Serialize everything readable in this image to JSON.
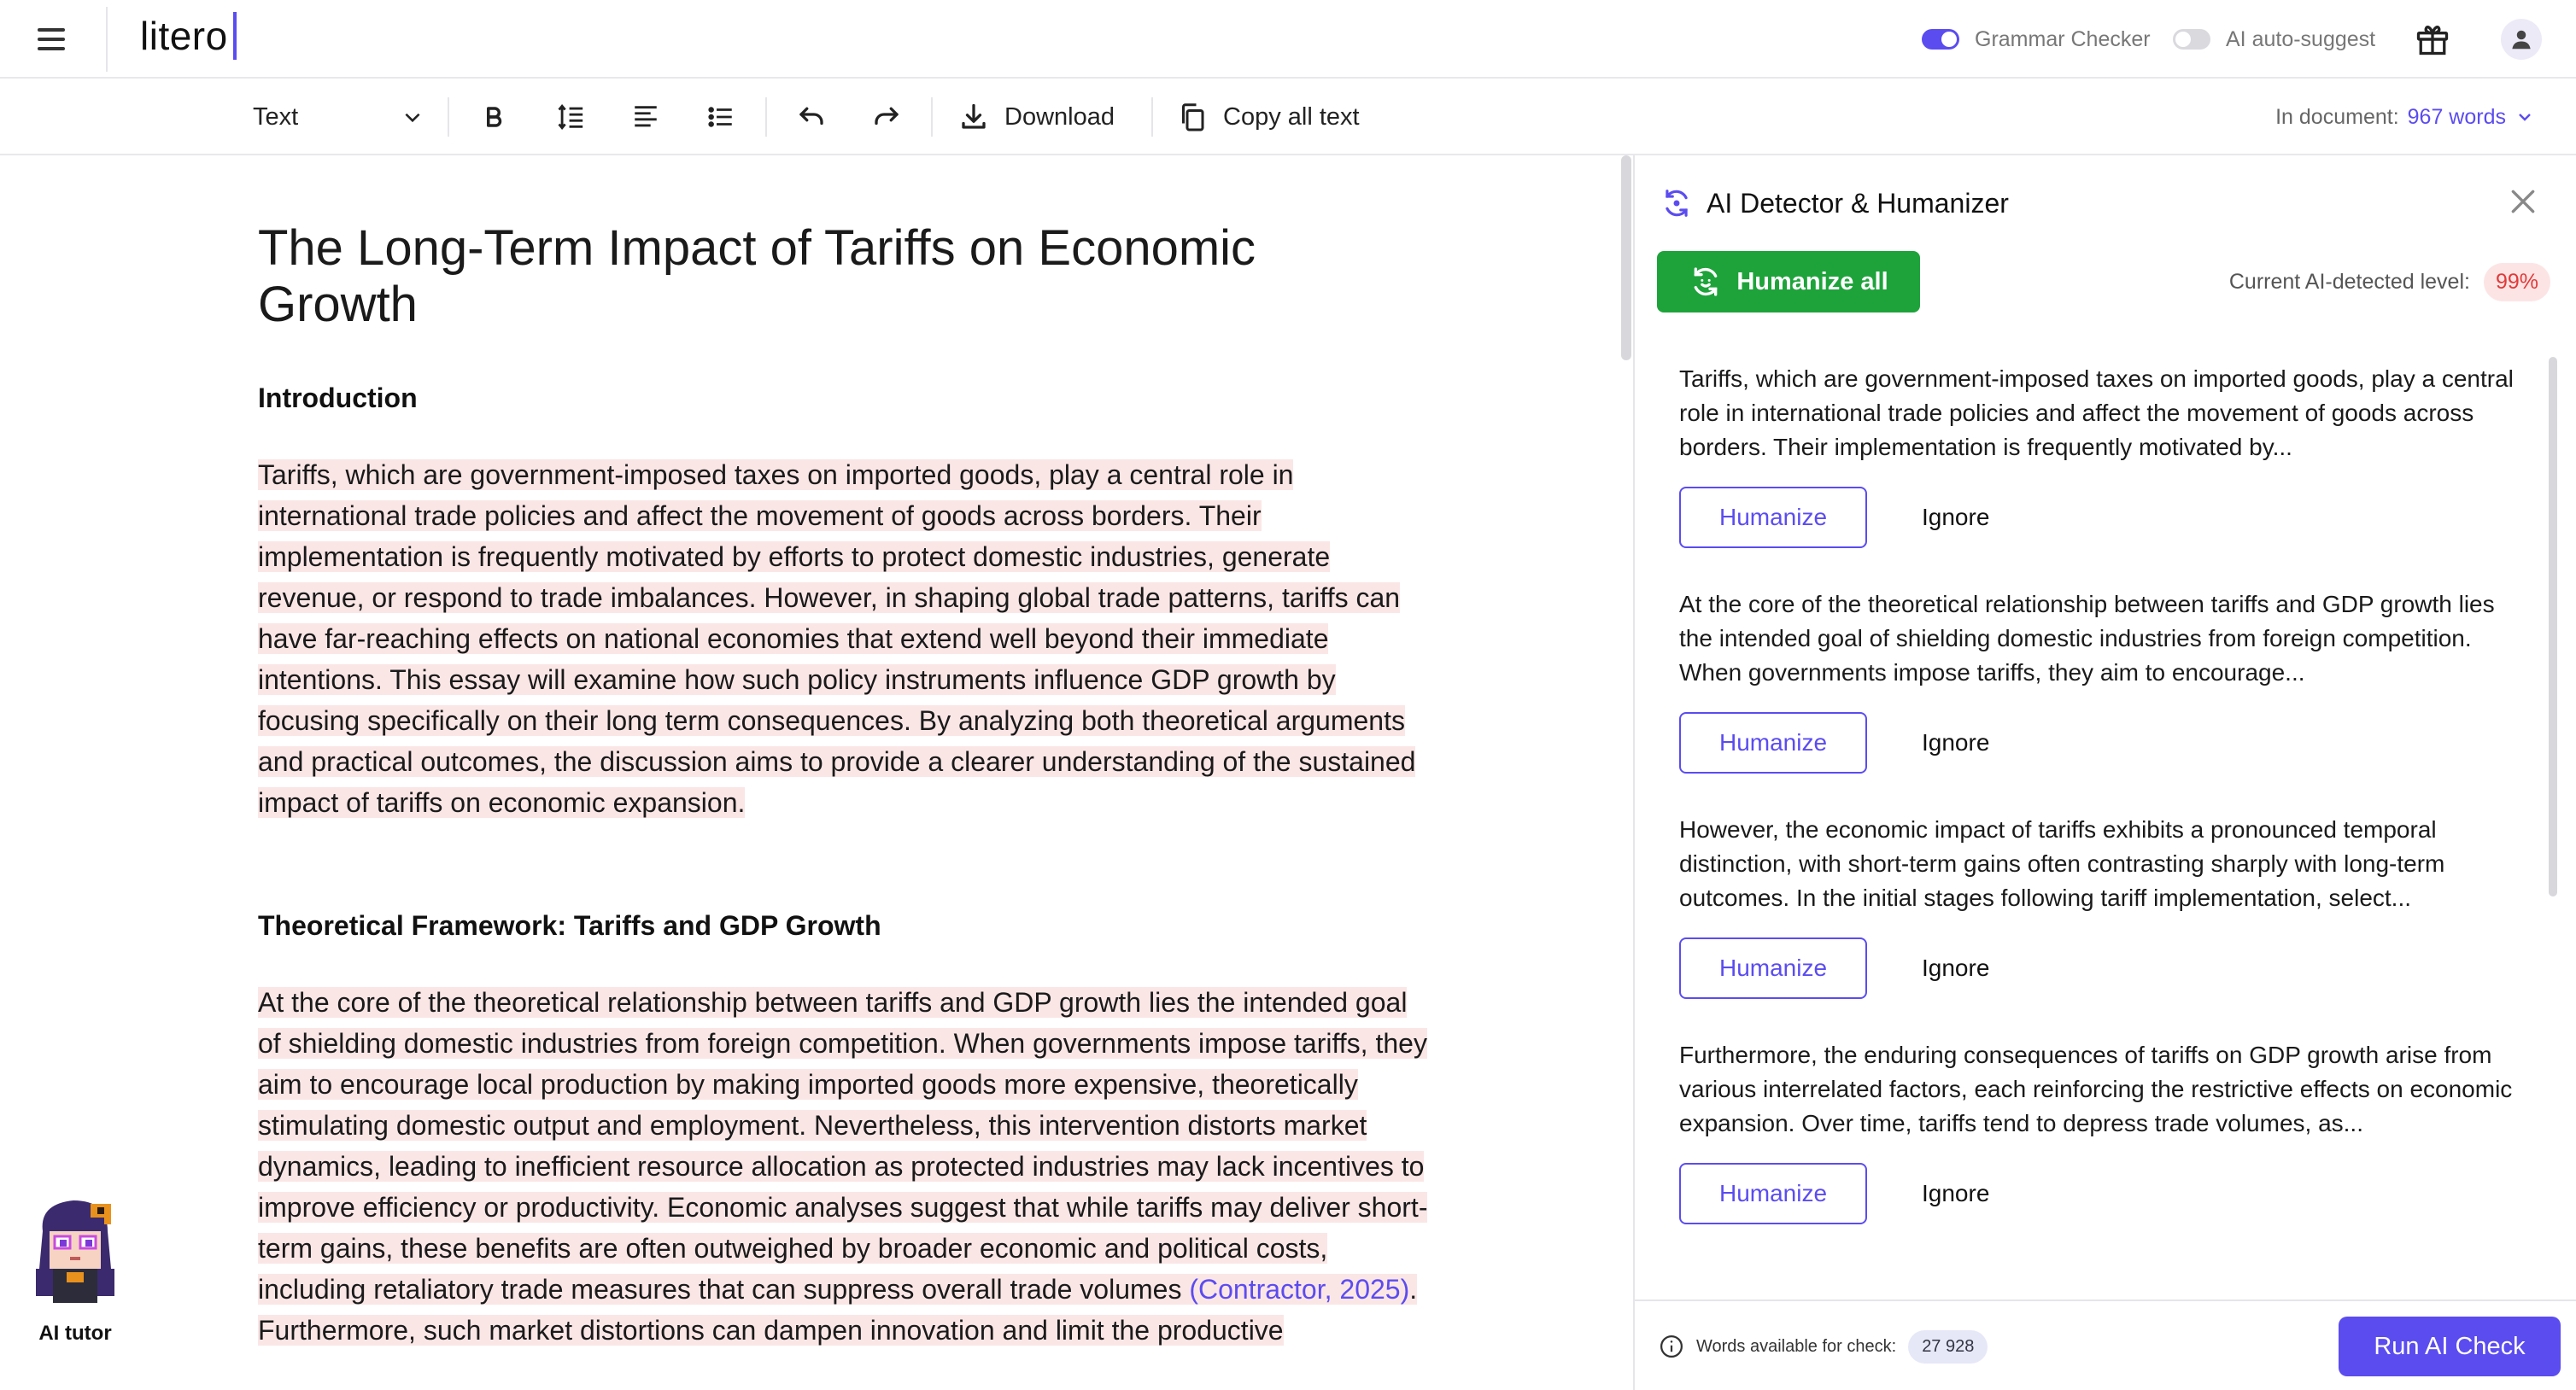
{
  "app": {
    "logo": "litero"
  },
  "topbar": {
    "grammar_checker": {
      "label": "Grammar Checker",
      "enabled": true
    },
    "ai_autosuggest": {
      "label": "AI auto-suggest",
      "enabled": false
    },
    "icons": [
      "menu-icon",
      "gift-icon",
      "user-icon"
    ]
  },
  "toolbar": {
    "text_style": "Text",
    "download_label": "Download",
    "copy_label": "Copy all text",
    "doc_count_label": "In document:",
    "doc_count_value": "967 words"
  },
  "document": {
    "title": "The Long-Term Impact of Tariffs on Economic Growth",
    "sections": [
      {
        "heading": "Introduction",
        "paragraph": "Tariffs, which are government-imposed taxes on imported goods, play a central role in international trade policies and affect the movement of goods across borders. Their implementation is frequently motivated by efforts to protect domestic industries, generate revenue, or respond to trade imbalances. However, in shaping global trade patterns, tariffs can have far-reaching effects on national economies that extend well beyond their immediate intentions. This essay will examine how such policy instruments influence GDP growth by focusing specifically on their long term consequences. By analyzing both theoretical arguments and practical outcomes, the discussion aims to provide a clearer understanding of the sustained impact of tariffs on economic expansion."
      },
      {
        "heading": "Theoretical Framework: Tariffs and GDP Growth",
        "paragraph_before_cite": "At the core of the theoretical relationship between tariffs and GDP growth lies the intended goal of shielding domestic industries from foreign competition. When governments impose tariffs, they aim to encourage local production by making imported goods more expensive, theoretically stimulating domestic output and employment. Nevertheless, this intervention distorts market dynamics, leading to inefficient resource allocation as protected industries may lack incentives to improve efficiency or productivity. Economic analyses suggest that while tariffs may deliver short-term gains, these benefits are often outweighed by broader economic and political costs, including retaliatory trade measures that can suppress overall trade volumes ",
        "citation": "(Contractor, 2025)",
        "paragraph_after_cite": ". Furthermore, such market distortions can dampen innovation and limit the productive"
      }
    ]
  },
  "ai_tutor": {
    "label": "AI tutor"
  },
  "panel": {
    "title": "AI Detector & Humanizer",
    "humanize_all_label": "Humanize all",
    "ai_level_label": "Current AI-detected level:",
    "ai_level_value": "99%",
    "suggestions": [
      {
        "text": "Tariffs, which are government-imposed taxes on imported goods, play a central role in international trade policies and affect the movement of goods across borders. Their implementation is frequently motivated by...",
        "humanize_label": "Humanize",
        "ignore_label": "Ignore"
      },
      {
        "text": "At the core of the theoretical relationship between tariffs and GDP growth lies the intended goal of shielding domestic industries from foreign competition. When governments impose tariffs, they aim to encourage...",
        "humanize_label": "Humanize",
        "ignore_label": "Ignore"
      },
      {
        "text": "However, the economic impact of tariffs exhibits a pronounced temporal distinction, with short-term gains often contrasting sharply with long-term outcomes. In the initial stages following tariff implementation, select...",
        "humanize_label": "Humanize",
        "ignore_label": "Ignore"
      },
      {
        "text": "Furthermore, the enduring consequences of tariffs on GDP growth arise from various interrelated factors, each reinforcing the restrictive effects on economic expansion. Over time, tariffs tend to depress trade volumes, as...",
        "humanize_label": "Humanize",
        "ignore_label": "Ignore"
      }
    ],
    "footer": {
      "words_label": "Words available for check:",
      "words_value": "27 928",
      "run_label": "Run AI Check"
    }
  },
  "colors": {
    "accent": "#5b4cf0",
    "humanize_green": "#1ea33b",
    "ai_highlight": "#fbe6e6",
    "ai_level_red": "#e03a3a"
  }
}
